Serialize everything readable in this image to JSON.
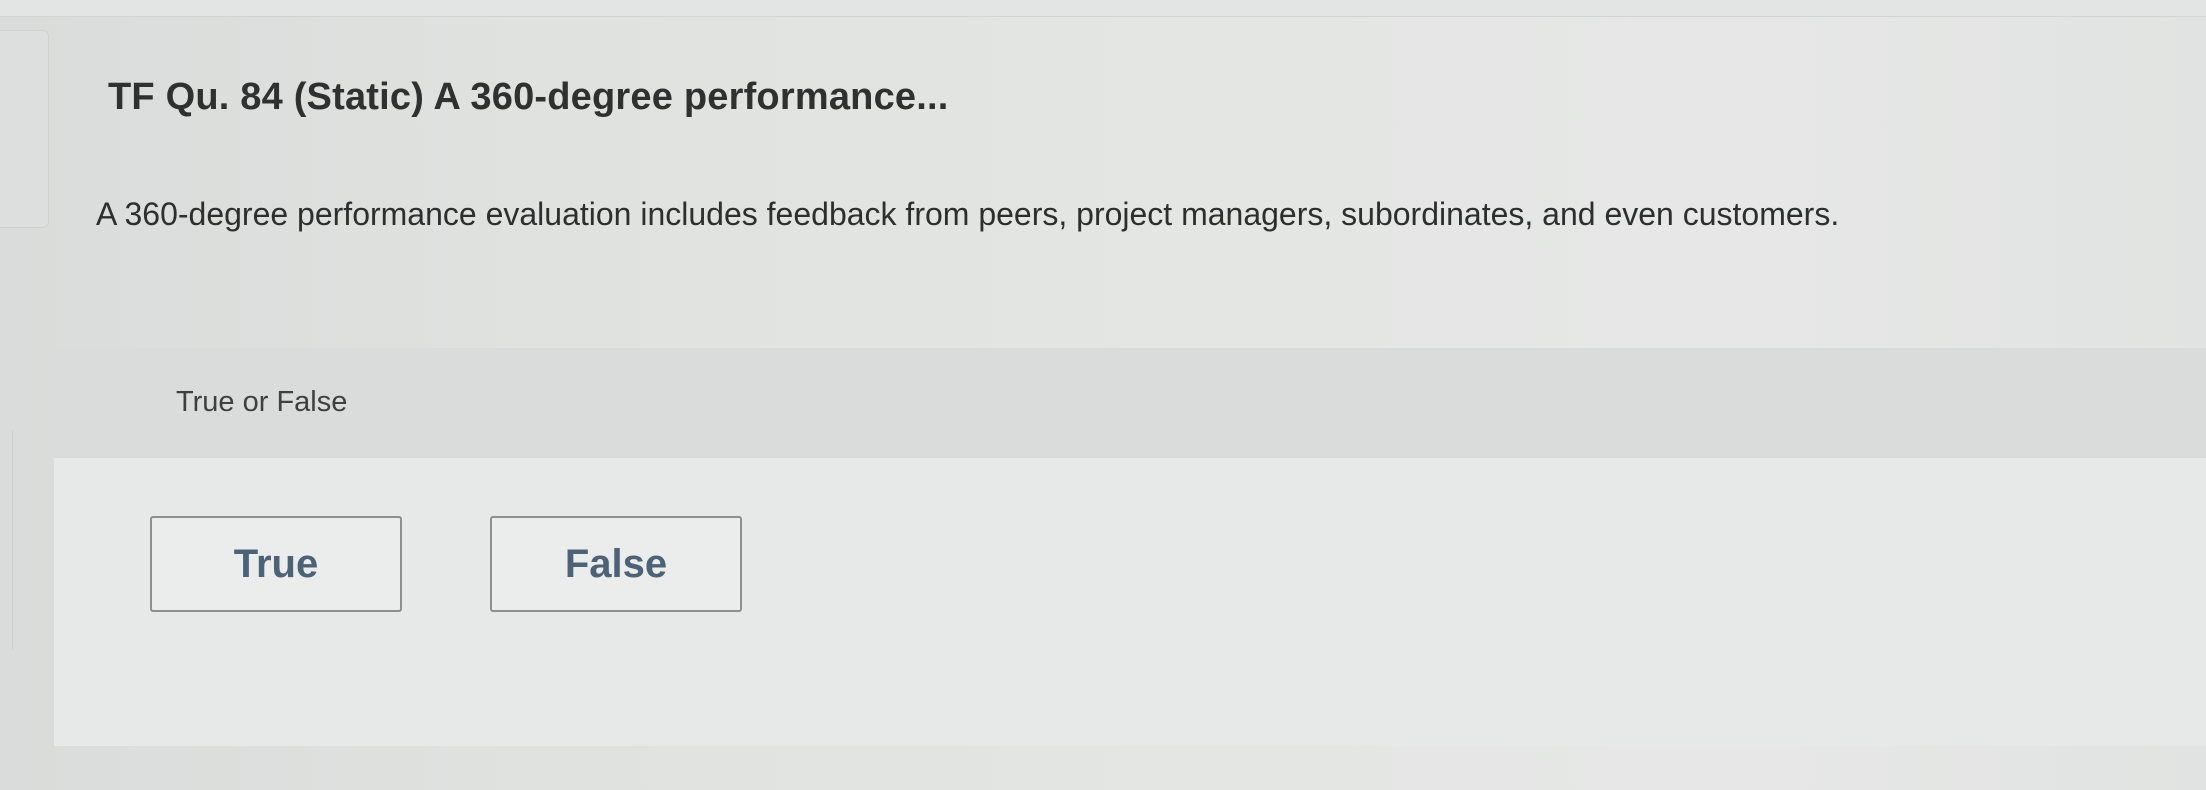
{
  "question": {
    "title": "TF Qu. 84 (Static) A 360-degree performance...",
    "prompt": "A 360-degree performance evaluation includes feedback from peers, project managers, subordinates, and even customers."
  },
  "answer": {
    "instruction": "True or False",
    "options": [
      {
        "label": "True"
      },
      {
        "label": "False"
      }
    ]
  },
  "colors": {
    "option_text": "#4d6277",
    "option_border": "#8d9091",
    "header_band": "#dadcdb"
  }
}
